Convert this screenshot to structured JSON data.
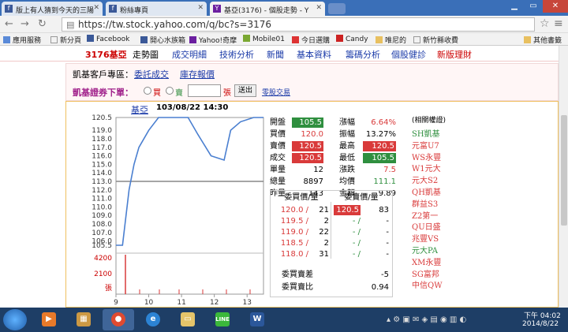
{
  "browser": {
    "tabs": [
      {
        "title": "版上有人猜到今天的三陽",
        "icon": "facebook-icon"
      },
      {
        "title": "粉絲專頁",
        "icon": "facebook-icon"
      },
      {
        "title": "基亞(3176) - 個股走勢 - Y",
        "icon": "yahoo-icon"
      }
    ],
    "url": "https://tw.stock.yahoo.com/q/bc?s=3176",
    "bookmarks": [
      "應用服務",
      "新分頁",
      "Facebook",
      "開心水族箱",
      "Yahoo!奇摩",
      "Mobile01",
      "今日選購",
      "Candy",
      "唯尼的",
      "新竹縣收費",
      "其他書籤"
    ]
  },
  "stock_menu": [
    "3176基亞",
    "走勢圖",
    "成交明細",
    "技術分析",
    "新聞",
    "基本資料",
    "籌碼分析",
    "個股健診",
    "新版理財"
  ],
  "info": {
    "client_label": "凱基客戶專區：",
    "client_links": [
      "委託成交",
      "庫存報價"
    ],
    "order_label": "凱基證券下單：",
    "buy": "買",
    "sell": "賣",
    "unit": "張",
    "submit": "送出",
    "odd_lot": "零股交易"
  },
  "chart": {
    "name": "基亞",
    "datetime": "103/08/22 14:30",
    "y_ticks": [
      "120.5",
      "119.0",
      "118.0",
      "117.0",
      "116.0",
      "115.0",
      "114.0",
      "113.0",
      "112.0",
      "111.0",
      "110.0",
      "109.0",
      "108.0",
      "107.0",
      "106.0",
      "105.5"
    ],
    "vol_ticks": [
      "4200",
      "2100",
      "張"
    ],
    "x_ticks": [
      "9",
      "10",
      "11",
      "12",
      "13"
    ]
  },
  "chart_data": {
    "type": "line",
    "x": [
      9.0,
      9.2,
      9.4,
      9.55,
      9.7,
      10.0,
      10.3,
      10.5,
      11.2,
      11.5,
      11.9,
      12.3,
      12.5,
      12.8,
      13.2,
      13.5
    ],
    "series": [
      {
        "values": [
          105.5,
          105.5,
          112.0,
          115.0,
          117.0,
          119.0,
          120.5,
          120.5,
          120.5,
          118.5,
          116.0,
          115.5,
          119.0,
          120.0,
          120.5,
          120.5
        ]
      }
    ],
    "reference_line": 113.0,
    "ylim": [
      105.5,
      120.5
    ],
    "xlim": [
      9,
      13.5
    ]
  },
  "quote": {
    "rows": [
      [
        "開盤",
        "105.5",
        "漲幅",
        "6.64%"
      ],
      [
        "買價",
        "120.0",
        "振幅",
        "13.27%"
      ],
      [
        "賣價",
        "120.5",
        "最高",
        "120.5"
      ],
      [
        "成交",
        "120.5",
        "最低",
        "105.5"
      ],
      [
        "單量",
        "12",
        "漲跌",
        "7.5"
      ],
      [
        "總量",
        "8897",
        "均價",
        "111.1"
      ],
      [
        "昨量",
        "143",
        "金額",
        "9.89"
      ]
    ],
    "book_header": [
      "委買價/量",
      "委賣價/量"
    ],
    "book": [
      [
        "120.0 /",
        "21",
        "120.5",
        "83"
      ],
      [
        "119.5 /",
        "2",
        "- /",
        "-"
      ],
      [
        "119.0 /",
        "22",
        "- /",
        "-"
      ],
      [
        "118.5 /",
        "2",
        "- /",
        "-"
      ],
      [
        "118.0 /",
        "31",
        "- /",
        "-"
      ]
    ],
    "diff_label": "委買賣差",
    "diff_value": "-5",
    "ratio_label": "委買賣比",
    "ratio_value": "0.94"
  },
  "warrants": {
    "title": "(相關權證)",
    "items": [
      "SH凱基",
      "元富U7",
      "WS永豐",
      "W1元大",
      "元大S2",
      "QH凱基",
      "群益S3",
      "Z2第一",
      "QU日盛",
      "兆豐VS",
      "元大PA",
      "XM永豐",
      "SG富邦",
      "中信QW"
    ]
  },
  "taskbar": {
    "time": "下午 04:02",
    "date": "2014/8/22",
    "apps": [
      "windows-icon",
      "media-player-icon",
      "files-icon",
      "chrome-icon",
      "ie-icon",
      "explorer-icon",
      "line-icon",
      "word-icon"
    ]
  },
  "colors": {
    "up": "#d93a3a",
    "green": "#2f8f3f",
    "link": "#1a3aa8",
    "line": "#4a7fd0"
  }
}
